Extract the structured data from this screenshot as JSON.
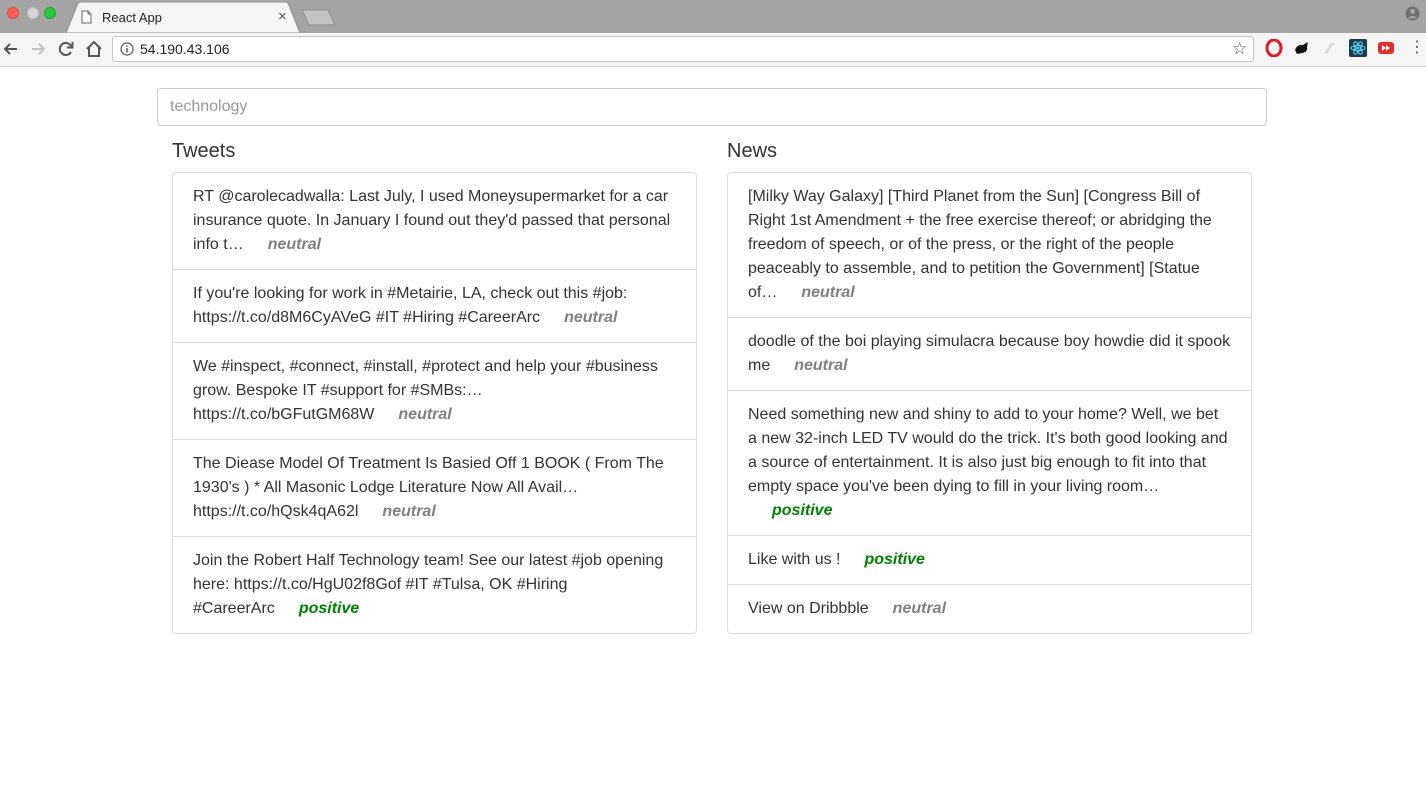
{
  "browser": {
    "tab_title": "React App",
    "tab_close": "×",
    "url": "54.190.43.106"
  },
  "search": {
    "placeholder": "technology"
  },
  "columns": {
    "tweets": {
      "title": "Tweets",
      "items": [
        {
          "text": "RT @carolecadwalla: Last July, I used Moneysupermarket for a car insurance quote. In January I found out they'd passed that personal info t…",
          "sentiment": "neutral"
        },
        {
          "text": "If you're looking for work in #Metairie, LA, check out this #job: https://t.co/d8M6CyAVeG #IT #Hiring #CareerArc",
          "sentiment": "neutral"
        },
        {
          "text": "We #inspect, #connect, #install, #protect and help your #business grow. Bespoke IT #support for #SMBs:… https://t.co/bGFutGM68W",
          "sentiment": "neutral"
        },
        {
          "text": "The Diease Model Of Treatment Is Basied Off 1 BOOK ( From The 1930's ) * All Masonic Lodge Literature Now All Avail… https://t.co/hQsk4qA62l",
          "sentiment": "neutral"
        },
        {
          "text": "Join the Robert Half Technology team! See our latest #job opening here: https://t.co/HgU02f8Gof #IT #Tulsa, OK #Hiring #CareerArc",
          "sentiment": "positive"
        }
      ]
    },
    "news": {
      "title": "News",
      "items": [
        {
          "text": "[Milky Way Galaxy] [Third Planet from the Sun] [Congress Bill of Right 1st Amendment + the free exercise thereof; or abridging the freedom of speech, or of the press, or the right of the people peaceably to assemble, and to petition the Government] [Statue of…",
          "sentiment": "neutral"
        },
        {
          "text": "doodle of the boi playing simulacra because boy howdie did it spook me",
          "sentiment": "neutral"
        },
        {
          "text": "Need something new and shiny to add to your home? Well, we bet a new 32-inch LED TV would do the trick. It's both good looking and a source of entertainment. It is also just big enough to fit into that empty space you've been dying to fill in your living room…",
          "sentiment": "positive"
        },
        {
          "text": "Like with us !",
          "sentiment": "positive"
        },
        {
          "text": "View on Dribbble",
          "sentiment": "neutral"
        }
      ]
    }
  },
  "colors": {
    "neutral": "#808080",
    "positive": "#008000"
  },
  "icons": [
    "document-icon",
    "close-icon",
    "new-tab-icon",
    "profile-icon",
    "back-icon",
    "forward-icon",
    "reload-icon",
    "home-icon",
    "info-icon",
    "star-icon",
    "opera-icon",
    "extension-icon",
    "react-icon",
    "youtube-icon",
    "menu-icon"
  ]
}
